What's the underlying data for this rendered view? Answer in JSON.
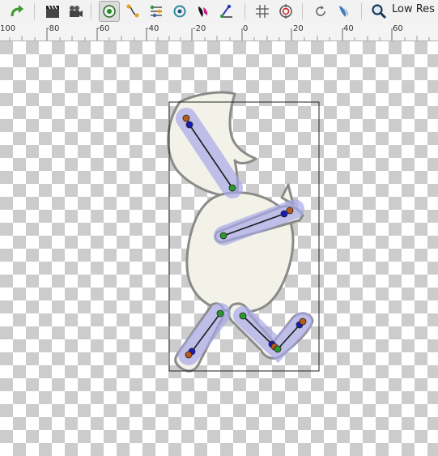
{
  "toolbar": {
    "redo": {
      "icon": "redo-arrow-icon"
    },
    "render_settings": {
      "icon": "clapperboard-icon"
    },
    "preview": {
      "icon": "camera-icon"
    },
    "tools": [
      {
        "name": "transform-tool",
        "icon": "circle-target-icon",
        "active": true
      },
      {
        "name": "smooth-move-tool",
        "icon": "smooth-move-icon",
        "active": false
      },
      {
        "name": "scale-tool",
        "icon": "scale-icon",
        "active": false
      },
      {
        "name": "rotate-tool",
        "icon": "rotate-icon",
        "active": false
      },
      {
        "name": "mirror-tool",
        "icon": "mirror-icon",
        "active": false
      },
      {
        "name": "bone-tool",
        "icon": "bone-icon",
        "active": false
      }
    ],
    "show_grid": {
      "icon": "grid-icon"
    },
    "onion_skin": {
      "icon": "onion-skin-icon"
    },
    "refresh": {
      "icon": "refresh-icon"
    },
    "toggle_background": {
      "icon": "background-rendering-icon"
    },
    "low_res": {
      "icon": "magnifier-icon",
      "label": "Low Res"
    }
  },
  "ruler": {
    "labels": [
      "100",
      "-80",
      "-60",
      "-40",
      "-20",
      "0",
      "20",
      "40",
      "60"
    ]
  },
  "canvas": {
    "checker_colors": [
      "#ffffff",
      "#cccccc"
    ],
    "figure_fill": "#f2f2e8",
    "figure_stroke": "#8a8a8a",
    "bone_highlight": "#a8a8e8",
    "vertex_colors": {
      "origin": "#2a9a2a",
      "joint": "#1a1ab8",
      "tip": "#b85a1a"
    }
  }
}
